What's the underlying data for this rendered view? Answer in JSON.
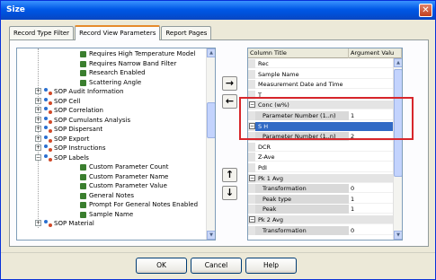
{
  "window": {
    "title": "Size",
    "close_glyph": "✕"
  },
  "tabs": [
    {
      "label": "Record Type Filter",
      "active": false
    },
    {
      "label": "Record View Parameters",
      "active": true
    },
    {
      "label": "Report Pages",
      "active": false
    }
  ],
  "tree": {
    "items": [
      {
        "label": "Requires High Temperature Model",
        "kind": "leaf",
        "level": 2
      },
      {
        "label": "Requires Narrow Band Filter",
        "kind": "leaf",
        "level": 2
      },
      {
        "label": "Research Enabled",
        "kind": "leaf",
        "level": 2
      },
      {
        "label": "Scattering Angle",
        "kind": "leaf",
        "level": 2
      },
      {
        "label": "SOP Audit Information",
        "kind": "node",
        "expander": "+",
        "level": 1
      },
      {
        "label": "SOP Cell",
        "kind": "node",
        "expander": "+",
        "level": 1
      },
      {
        "label": "SOP Correlation",
        "kind": "node",
        "expander": "+",
        "level": 1
      },
      {
        "label": "SOP Cumulants Analysis",
        "kind": "node",
        "expander": "+",
        "level": 1
      },
      {
        "label": "SOP Dispersant",
        "kind": "node",
        "expander": "+",
        "level": 1
      },
      {
        "label": "SOP Export",
        "kind": "node",
        "expander": "+",
        "level": 1
      },
      {
        "label": "SOP Instructions",
        "kind": "node",
        "expander": "+",
        "level": 1
      },
      {
        "label": "SOP Labels",
        "kind": "node",
        "expander": "−",
        "level": 1
      },
      {
        "label": "Custom Parameter Count",
        "kind": "leaf",
        "level": 2
      },
      {
        "label": "Custom Parameter Name",
        "kind": "leaf",
        "level": 2
      },
      {
        "label": "Custom Parameter Value",
        "kind": "leaf",
        "level": 2
      },
      {
        "label": "General Notes",
        "kind": "leaf",
        "level": 2
      },
      {
        "label": "Prompt For General Notes Enabled",
        "kind": "leaf",
        "level": 2
      },
      {
        "label": "Sample Name",
        "kind": "leaf",
        "level": 2
      },
      {
        "label": "SOP Material",
        "kind": "node",
        "expander": "+",
        "level": 1
      }
    ]
  },
  "transfer": {
    "add": "→",
    "remove": "←",
    "up": "↑",
    "down": "↓"
  },
  "grid": {
    "columns": [
      "Column Title",
      "Argument Valu"
    ],
    "rows": [
      {
        "title": "Rec",
        "value": "",
        "type": "plain"
      },
      {
        "title": "Sample Name",
        "value": "",
        "type": "plain"
      },
      {
        "title": "Measurement Date and Time",
        "value": "",
        "type": "plain"
      },
      {
        "title": "T",
        "value": "",
        "type": "plain"
      },
      {
        "title": "Conc (w%)",
        "value": "",
        "type": "cat",
        "expander": "−"
      },
      {
        "title": "Parameter Number (1..n)",
        "value": "1",
        "type": "sub"
      },
      {
        "title": "S     H",
        "value": "",
        "type": "cat-selected",
        "expander": "−"
      },
      {
        "title": "Parameter Number (1..n)",
        "value": "2",
        "type": "sub"
      },
      {
        "title": "DCR",
        "value": "",
        "type": "plain"
      },
      {
        "title": "Z-Ave",
        "value": "",
        "type": "plain"
      },
      {
        "title": "PdI",
        "value": "",
        "type": "plain"
      },
      {
        "title": "Pk 1 Avg",
        "value": "",
        "type": "cat",
        "expander": "−"
      },
      {
        "title": "Transformation",
        "value": "0",
        "type": "sub"
      },
      {
        "title": "Peak type",
        "value": "1",
        "type": "sub"
      },
      {
        "title": "Peak",
        "value": "1",
        "type": "sub"
      },
      {
        "title": "Pk 2 Avg",
        "value": "",
        "type": "cat",
        "expander": "−"
      },
      {
        "title": "Transformation",
        "value": "0",
        "type": "sub"
      }
    ]
  },
  "buttons": {
    "ok": "OK",
    "cancel": "Cancel",
    "help": "Help"
  },
  "colors": {
    "titlebar": "#0058e6",
    "selection": "#316ac5",
    "highlight_box": "#d7262b",
    "tab_accent": "#e68b2c"
  }
}
